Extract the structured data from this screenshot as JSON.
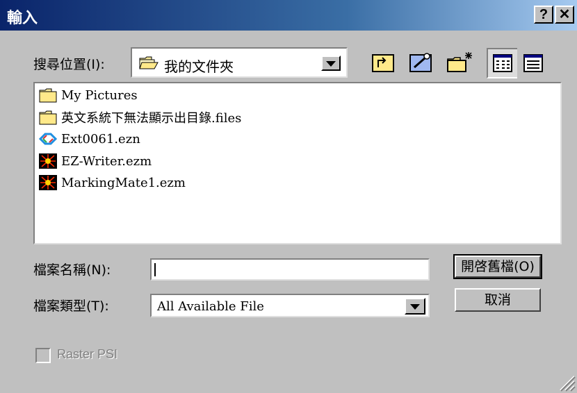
{
  "window": {
    "title": "輸入",
    "help_button": "?",
    "close_button": "✕"
  },
  "lookin": {
    "label": "搜尋位置(I):",
    "value": "我的文件夾"
  },
  "toolbar": {
    "icons": [
      "up-folder-icon",
      "desktop-icon",
      "new-folder-icon",
      "list-view-icon",
      "details-view-icon"
    ]
  },
  "files": [
    {
      "name": "My Pictures",
      "icon": "folder-icon"
    },
    {
      "name": "英文系統下無法顯示出目錄.files",
      "icon": "folder-icon"
    },
    {
      "name": "Ext0061.ezn",
      "icon": "ezn-file-icon"
    },
    {
      "name": "EZ-Writer.ezm",
      "icon": "ezm-file-icon"
    },
    {
      "name": "MarkingMate1.ezm",
      "icon": "ezm-file-icon"
    }
  ],
  "filename": {
    "label": "檔案名稱(N):",
    "value": ""
  },
  "filetype": {
    "label": "檔案類型(T):",
    "value": "All Available File"
  },
  "buttons": {
    "open": "開啓舊檔(O)",
    "cancel": "取消"
  },
  "option": {
    "label": "Raster PSI",
    "checked": false,
    "enabled": false
  }
}
